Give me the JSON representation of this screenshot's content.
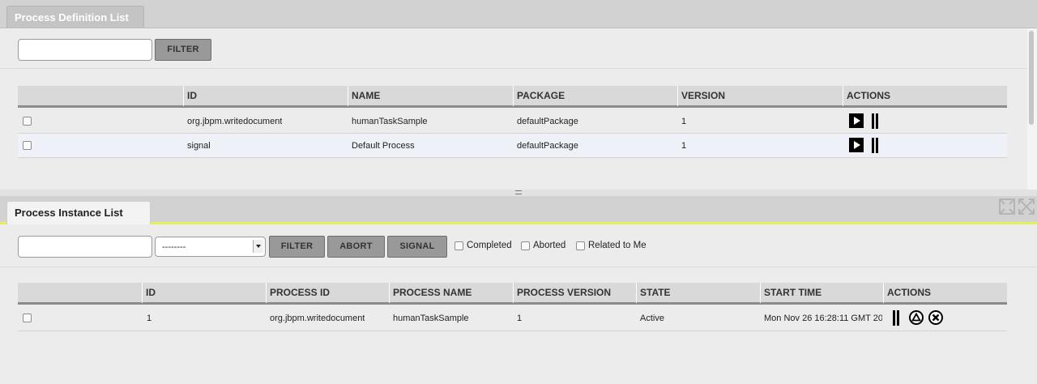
{
  "definitions": {
    "tab_label": "Process Definition List",
    "filter": {
      "value": "",
      "button": "FILTER"
    },
    "columns": [
      "ID",
      "NAME",
      "PACKAGE",
      "VERSION",
      "ACTIONS"
    ],
    "rows": [
      {
        "id": "org.jbpm.writedocument",
        "name": "humanTaskSample",
        "package": "defaultPackage",
        "version": "1",
        "actions": [
          "play-icon",
          "details-icon"
        ]
      },
      {
        "id": "signal",
        "name": "Default Process",
        "package": "defaultPackage",
        "version": "1",
        "actions": [
          "play-icon",
          "details-icon"
        ]
      }
    ]
  },
  "splitter_glyph": "=",
  "instances": {
    "tab_label": "Process Instance List",
    "filter": {
      "value": "",
      "select_value": "--------",
      "filter_button": "FILTER",
      "abort_button": "ABORT",
      "signal_button": "SIGNAL"
    },
    "checkboxes": [
      "Completed",
      "Aborted",
      "Related to Me"
    ],
    "columns": [
      "ID",
      "PROCESS ID",
      "PROCESS NAME",
      "PROCESS VERSION",
      "STATE",
      "START TIME",
      "ACTIONS"
    ],
    "rows": [
      {
        "id": "1",
        "process_id": "org.jbpm.writedocument",
        "process_name": "humanTaskSample",
        "process_version": "1",
        "state": "Active",
        "start_time": "Mon Nov 26 16:28:11 GMT 20",
        "actions": [
          "details-icon",
          "signal-icon",
          "abort-icon"
        ]
      }
    ]
  },
  "colors": {
    "accent": "#e6ee5a",
    "button": "#999999",
    "header_rule": "#8c8c8c",
    "alt_row": "#eef2f8"
  }
}
